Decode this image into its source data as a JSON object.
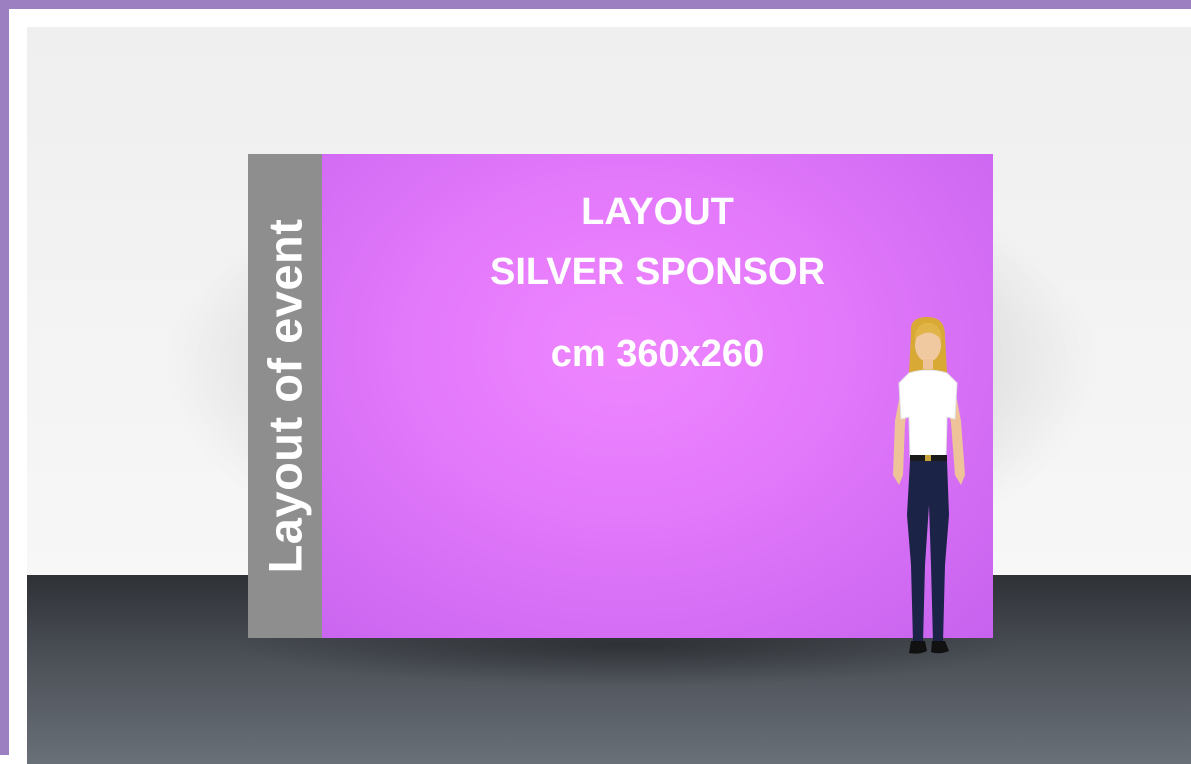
{
  "side_text": "Layout of event",
  "title_line1": "LAYOUT",
  "title_line2": "SILVER SPONSOR",
  "size_label": "cm 360x260",
  "colors": {
    "frame": "#9b7fc0",
    "panel": "#e47cfc",
    "strip": "#8e8e8e",
    "floor": "#4c5158"
  }
}
